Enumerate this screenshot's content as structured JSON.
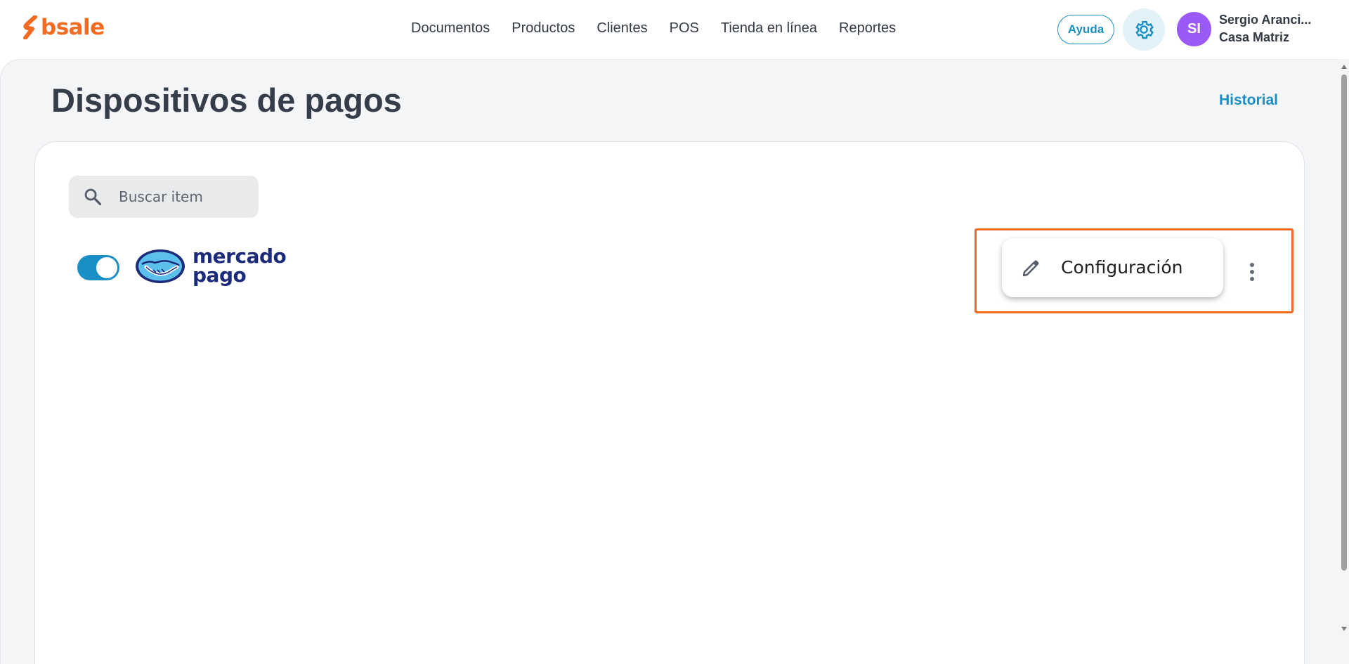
{
  "brand": {
    "logo_text": "bsale",
    "accent_color": "#f26b21"
  },
  "nav": {
    "items": [
      {
        "label": "Documentos"
      },
      {
        "label": "Productos"
      },
      {
        "label": "Clientes"
      },
      {
        "label": "POS"
      },
      {
        "label": "Tienda en línea"
      },
      {
        "label": "Reportes"
      }
    ]
  },
  "header": {
    "help_label": "Ayuda",
    "settings_icon": "gear-icon",
    "avatar_initials": "SI",
    "avatar_color": "#9b59f6",
    "user_name": "Sergio Aranci...",
    "branch": "Casa Matriz"
  },
  "page": {
    "title": "Dispositivos de pagos",
    "history_link": "Historial"
  },
  "search": {
    "placeholder": "Buscar item",
    "value": ""
  },
  "devices": [
    {
      "enabled": true,
      "logo_line1": "mercado",
      "logo_line2": "pago",
      "logo_color": "#1c2a7a"
    }
  ],
  "context_menu": {
    "items": [
      {
        "label": "Configuración",
        "icon": "pencil-icon"
      }
    ],
    "highlight_color": "#f26b21"
  },
  "colors": {
    "primary": "#1a8fc4",
    "page_bg": "#f4f5f7"
  }
}
